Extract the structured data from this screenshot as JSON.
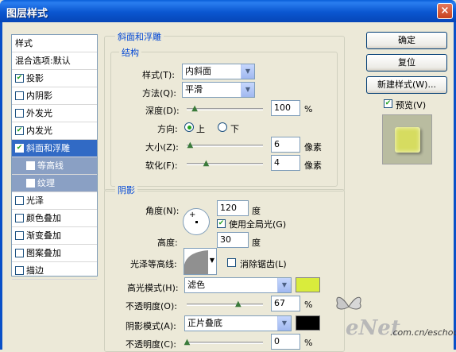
{
  "window": {
    "title": "图层样式",
    "close_glyph": "×"
  },
  "sidebar": {
    "items": [
      {
        "label": "样式",
        "checkbox": false,
        "checked": false,
        "state": "header"
      },
      {
        "label": "混合选项:默认",
        "checkbox": false,
        "checked": false,
        "state": "normal"
      },
      {
        "label": "投影",
        "checkbox": true,
        "checked": true,
        "state": "normal"
      },
      {
        "label": "内阴影",
        "checkbox": true,
        "checked": false,
        "state": "normal"
      },
      {
        "label": "外发光",
        "checkbox": true,
        "checked": false,
        "state": "normal"
      },
      {
        "label": "内发光",
        "checkbox": true,
        "checked": true,
        "state": "normal"
      },
      {
        "label": "斜面和浮雕",
        "checkbox": true,
        "checked": true,
        "state": "selected"
      },
      {
        "label": "等高线",
        "checkbox": true,
        "checked": false,
        "state": "sub"
      },
      {
        "label": "纹理",
        "checkbox": true,
        "checked": false,
        "state": "sub"
      },
      {
        "label": "光泽",
        "checkbox": true,
        "checked": false,
        "state": "normal"
      },
      {
        "label": "颜色叠加",
        "checkbox": true,
        "checked": false,
        "state": "normal"
      },
      {
        "label": "渐变叠加",
        "checkbox": true,
        "checked": false,
        "state": "normal"
      },
      {
        "label": "图案叠加",
        "checkbox": true,
        "checked": false,
        "state": "normal"
      },
      {
        "label": "描边",
        "checkbox": true,
        "checked": false,
        "state": "normal"
      }
    ]
  },
  "bevel": {
    "group_title": "斜面和浮雕",
    "structure_title": "结构",
    "style_label": "样式(T):",
    "style_value": "内斜面",
    "technique_label": "方法(Q):",
    "technique_value": "平滑",
    "depth_label": "深度(D):",
    "depth_value": "100",
    "depth_unit": "%",
    "depth_fraction": 0.1,
    "direction_label": "方向:",
    "direction_up": "上",
    "direction_down": "下",
    "direction_selected": "上",
    "size_label": "大小(Z):",
    "size_value": "6",
    "size_unit": "像素",
    "size_fraction": 0.04,
    "soften_label": "软化(F):",
    "soften_value": "4",
    "soften_unit": "像素",
    "soften_fraction": 0.25
  },
  "shading": {
    "title": "阴影",
    "angle_label": "角度(N):",
    "angle_value": "120",
    "angle_unit": "度",
    "global_light_label": "使用全局光(G)",
    "global_light_checked": true,
    "altitude_label": "高度:",
    "altitude_value": "30",
    "altitude_unit": "度",
    "gloss_label": "光泽等高线:",
    "antialias_label": "消除锯齿(L)",
    "antialias_checked": false,
    "highlight_mode_label": "高光模式(H):",
    "highlight_mode_value": "滤色",
    "highlight_color": "#d9ec3c",
    "highlight_opacity_label": "不透明度(O):",
    "highlight_opacity_value": "67",
    "highlight_opacity_unit": "%",
    "highlight_opacity_fraction": 0.67,
    "shadow_mode_label": "阴影模式(A):",
    "shadow_mode_value": "正片叠底",
    "shadow_color": "#000000",
    "shadow_opacity_label": "不透明度(C):",
    "shadow_opacity_value": "0",
    "shadow_opacity_unit": "%",
    "shadow_opacity_fraction": 0.0
  },
  "buttons": {
    "ok": "确定",
    "reset": "复位",
    "new_style": "新建样式(W)...",
    "preview_label": "预览(V)",
    "preview_checked": true
  },
  "preview_colors": {
    "outer": "#b9bca0",
    "inner": "#d6dc60"
  },
  "watermark": {
    "brand": "eNet",
    "url": ".com.cn/eschool"
  },
  "icons": {
    "dropdown": "chevron-down-icon",
    "check": "checkmark-icon"
  }
}
